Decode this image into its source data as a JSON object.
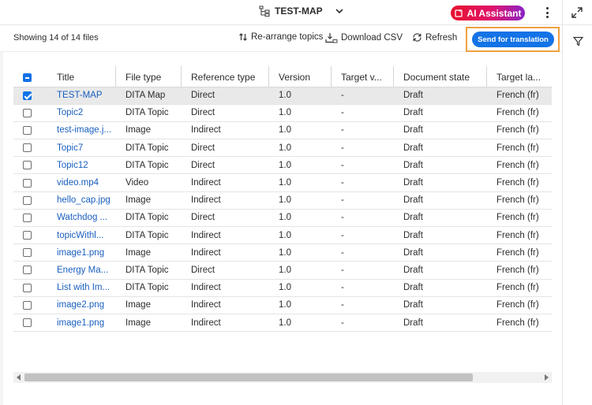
{
  "header": {
    "map_title": "TEST-MAP",
    "ai_assistant_label": "AI Assistant",
    "ai_gradient": [
      "#e8112d",
      "#8a23c6"
    ],
    "icons": [
      "map-icon",
      "chevron-down-icon",
      "ai-icon",
      "more-vertical-icon",
      "expand-icon"
    ]
  },
  "toolbar": {
    "showing": "Showing 14 of 14 files",
    "rearrange_label": "Re-arrange topics",
    "download_label": "Download CSV",
    "refresh_label": "Refresh",
    "send_label": "Send for translation",
    "accent": "#1473e6",
    "highlight": "#f0a040"
  },
  "table": {
    "columns": [
      "Title",
      "File type",
      "Reference type",
      "Version",
      "Target v...",
      "Document state",
      "Target la..."
    ],
    "rows": [
      {
        "title": "TEST-MAP",
        "type": "DITA Map",
        "ref": "Direct",
        "version": "1.0",
        "target_version": "-",
        "state": "Draft",
        "target_lang": "French (fr)",
        "checked": true
      },
      {
        "title": "Topic2",
        "type": "DITA Topic",
        "ref": "Direct",
        "version": "1.0",
        "target_version": "-",
        "state": "Draft",
        "target_lang": "French (fr)",
        "checked": false
      },
      {
        "title": "test-image.j...",
        "type": "Image",
        "ref": "Indirect",
        "version": "1.0",
        "target_version": "-",
        "state": "Draft",
        "target_lang": "French (fr)",
        "checked": false
      },
      {
        "title": "Topic7",
        "type": "DITA Topic",
        "ref": "Direct",
        "version": "1.0",
        "target_version": "-",
        "state": "Draft",
        "target_lang": "French (fr)",
        "checked": false
      },
      {
        "title": "Topic12",
        "type": "DITA Topic",
        "ref": "Direct",
        "version": "1.0",
        "target_version": "-",
        "state": "Draft",
        "target_lang": "French (fr)",
        "checked": false
      },
      {
        "title": "video.mp4",
        "type": "Video",
        "ref": "Indirect",
        "version": "1.0",
        "target_version": "-",
        "state": "Draft",
        "target_lang": "French (fr)",
        "checked": false
      },
      {
        "title": "hello_cap.jpg",
        "type": "Image",
        "ref": "Indirect",
        "version": "1.0",
        "target_version": "-",
        "state": "Draft",
        "target_lang": "French (fr)",
        "checked": false
      },
      {
        "title": "Watchdog ...",
        "type": "DITA Topic",
        "ref": "Direct",
        "version": "1.0",
        "target_version": "-",
        "state": "Draft",
        "target_lang": "French (fr)",
        "checked": false
      },
      {
        "title": "topicWithl...",
        "type": "DITA Topic",
        "ref": "Indirect",
        "version": "1.0",
        "target_version": "-",
        "state": "Draft",
        "target_lang": "French (fr)",
        "checked": false
      },
      {
        "title": "image1.png",
        "type": "Image",
        "ref": "Indirect",
        "version": "1.0",
        "target_version": "-",
        "state": "Draft",
        "target_lang": "French (fr)",
        "checked": false
      },
      {
        "title": "Energy Ma...",
        "type": "DITA Topic",
        "ref": "Direct",
        "version": "1.0",
        "target_version": "-",
        "state": "Draft",
        "target_lang": "French (fr)",
        "checked": false
      },
      {
        "title": "List with Im...",
        "type": "DITA Topic",
        "ref": "Indirect",
        "version": "1.0",
        "target_version": "-",
        "state": "Draft",
        "target_lang": "French (fr)",
        "checked": false
      },
      {
        "title": "image2.png",
        "type": "Image",
        "ref": "Indirect",
        "version": "1.0",
        "target_version": "-",
        "state": "Draft",
        "target_lang": "French (fr)",
        "checked": false
      },
      {
        "title": "image1.png",
        "type": "Image",
        "ref": "Indirect",
        "version": "1.0",
        "target_version": "-",
        "state": "Draft",
        "target_lang": "French (fr)",
        "checked": false
      }
    ]
  }
}
